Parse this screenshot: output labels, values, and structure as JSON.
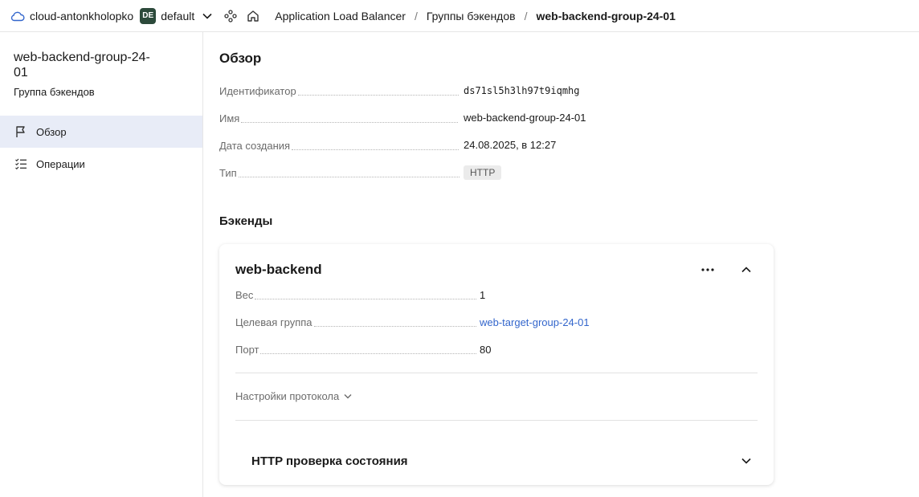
{
  "header": {
    "cloud_name": "cloud-antonkholopko",
    "folder_badge": "DE",
    "folder_name": "default",
    "breadcrumbs": [
      {
        "label": "Application Load Balancer"
      },
      {
        "label": "Группы бэкендов"
      },
      {
        "label": "web-backend-group-24-01"
      }
    ],
    "separator": "/"
  },
  "sidebar": {
    "title": "web-backend-group-24-01",
    "subtitle": "Группа бэкендов",
    "items": [
      {
        "label": "Обзор",
        "active": true
      },
      {
        "label": "Операции",
        "active": false
      }
    ]
  },
  "overview": {
    "heading": "Обзор",
    "props": [
      {
        "label": "Идентификатор",
        "value": "ds71sl5h3lh97t9iqmhg"
      },
      {
        "label": "Имя",
        "value": "web-backend-group-24-01"
      },
      {
        "label": "Дата создания",
        "value": "24.08.2025, в 12:27"
      },
      {
        "label": "Тип",
        "value": "HTTP"
      }
    ]
  },
  "backends": {
    "heading": "Бэкенды",
    "card": {
      "title": "web-backend",
      "props": [
        {
          "label": "Вес",
          "value": "1"
        },
        {
          "label": "Целевая группа",
          "value": "web-target-group-24-01"
        },
        {
          "label": "Порт",
          "value": "80"
        }
      ],
      "protocol_settings": "Настройки протокола",
      "healthcheck_title": "HTTP проверка состояния"
    }
  },
  "colors": {
    "accent_link": "#3366cc",
    "active_nav_bg": "#e8ecf7",
    "folder_badge_bg": "#2c4a3b"
  }
}
